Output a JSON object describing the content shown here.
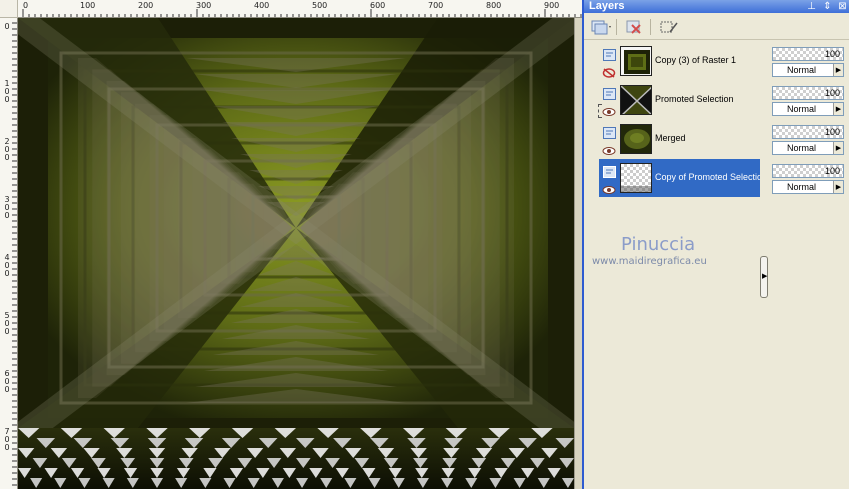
{
  "ruler": {
    "h_labels": [
      "0",
      "100",
      "200",
      "300",
      "400",
      "500",
      "600",
      "700",
      "800",
      "900"
    ],
    "v_labels": [
      "0",
      "100",
      "200",
      "300",
      "400",
      "500",
      "600",
      "700"
    ]
  },
  "layers_panel": {
    "title": "Layers",
    "layers": [
      {
        "name": "Copy (3) of Raster 1",
        "opacity": "100",
        "blend_mode": "Normal",
        "visible": false,
        "selected": false
      },
      {
        "name": "Promoted Selection",
        "opacity": "100",
        "blend_mode": "Normal",
        "visible": true,
        "selected": false
      },
      {
        "name": "Merged",
        "opacity": "100",
        "blend_mode": "Normal",
        "visible": true,
        "selected": false
      },
      {
        "name": "Copy of Promoted Selection",
        "opacity": "100",
        "blend_mode": "Normal",
        "visible": true,
        "selected": true
      }
    ]
  },
  "watermark": {
    "name": "Pinuccia",
    "url": "www.maidiregrafica.eu"
  },
  "colors": {
    "selection": "#316ac5",
    "titlebar": "#3e6fd8",
    "artwork_olive": "#7f8b1f",
    "artwork_dark": "#1c1f07"
  }
}
